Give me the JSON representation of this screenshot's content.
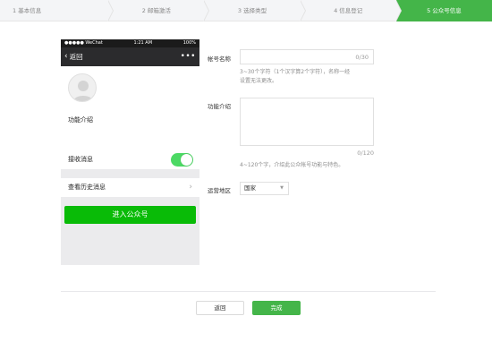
{
  "steps": [
    {
      "label": "1 基本信息"
    },
    {
      "label": "2 邮箱激活"
    },
    {
      "label": "3 选择类型"
    },
    {
      "label": "4 信息登记"
    },
    {
      "label": "5 公众号信息"
    }
  ],
  "phone": {
    "carrier": "●●●●● WeChat",
    "time": "1:21 AM",
    "battery": "100%",
    "back_label": "返回",
    "more": "•••",
    "intro_label": "功能介绍",
    "receive_label": "接收消息",
    "receive_on": true,
    "history_label": "查看历史消息",
    "enter_button": "进入公众号"
  },
  "form": {
    "name_label": "帐号名称",
    "name_value": "",
    "name_counter": "0/30",
    "name_hint_1": "3~30个字符（1个汉字算2个字符），名称一经",
    "name_hint_2": "设置无法更改。",
    "intro_label": "功能介绍",
    "intro_value": "",
    "intro_counter": "0/120",
    "intro_hint": "4~120个字，介绍此公众帐号功能与特色。",
    "region_label": "运营地区",
    "region_value": "国家"
  },
  "footer": {
    "back_button": "返回",
    "done_button": "完成"
  },
  "colors": {
    "accent": "#44b549",
    "enter_button": "#09bb07",
    "toggle_on": "#4cd964"
  }
}
